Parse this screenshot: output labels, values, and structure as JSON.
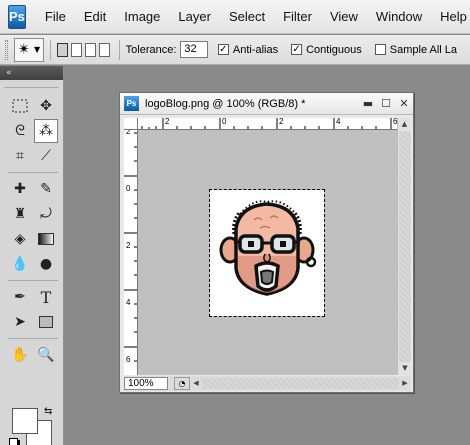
{
  "app": {
    "logo": "Ps"
  },
  "menu": [
    "File",
    "Edit",
    "Image",
    "Layer",
    "Select",
    "Filter",
    "View",
    "Window",
    "Help"
  ],
  "options": {
    "tolerance_label": "Tolerance:",
    "tolerance_value": "32",
    "anti_alias_label": "Anti-alias",
    "anti_alias_checked": true,
    "contiguous_label": "Contiguous",
    "contiguous_checked": true,
    "sample_all_label": "Sample All La",
    "sample_all_checked": false
  },
  "tools_panel": {
    "collapse_glyph": "«"
  },
  "document": {
    "title": "logoBlog.png @ 100% (RGB/8) *",
    "icon": "Ps",
    "zoom": "100%",
    "hruler_labels": [
      "2",
      "0",
      "2",
      "4",
      "6"
    ],
    "vruler_labels": [
      "2",
      "0",
      "2",
      "4",
      "6"
    ]
  },
  "colors": {
    "foreground": "#ffffff",
    "background": "#ffffff",
    "canvas_bg": "#c0c0c0",
    "ps_blue": "#0c5aa6"
  }
}
